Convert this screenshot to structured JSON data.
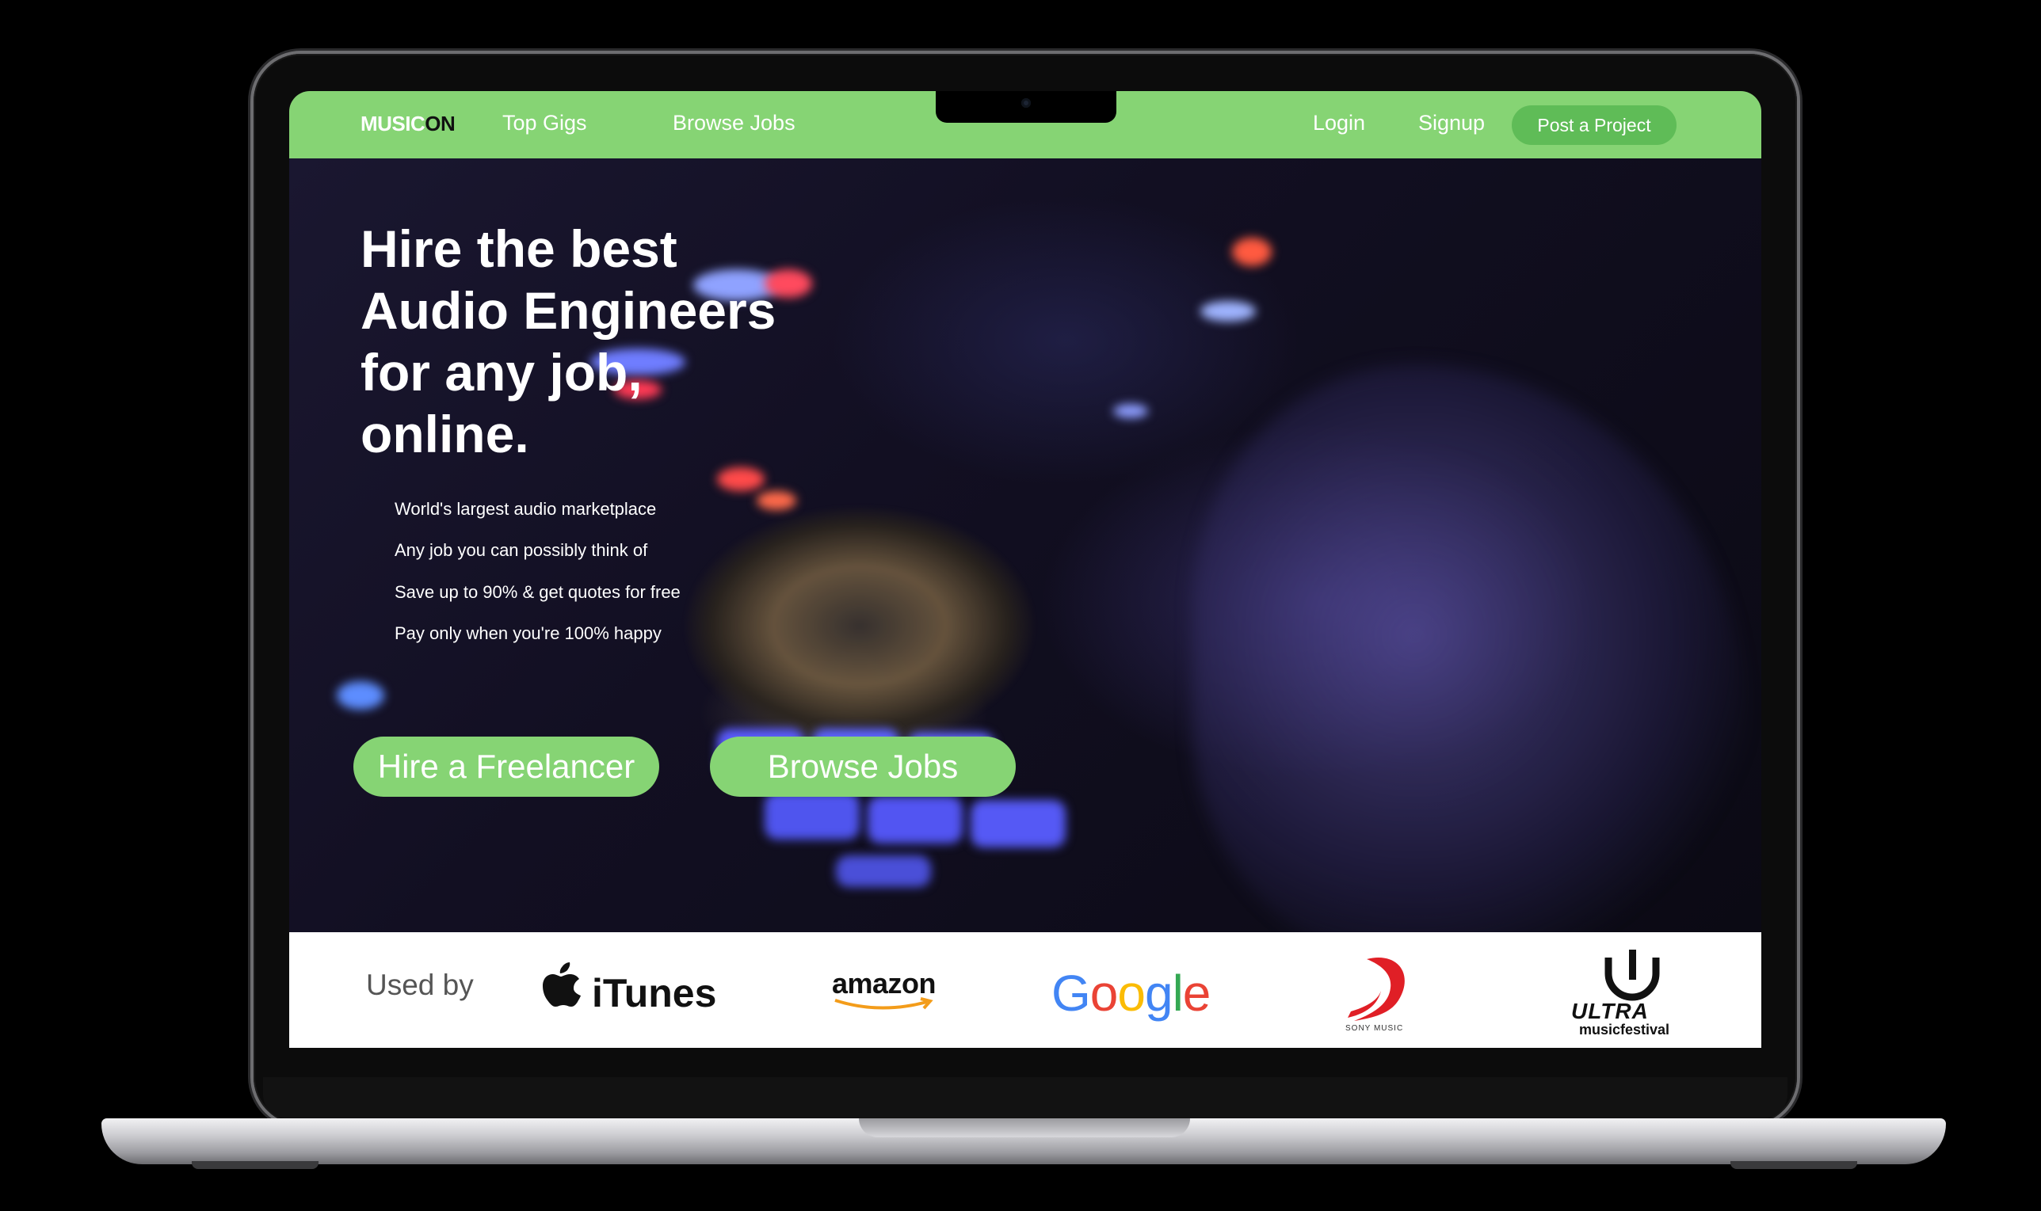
{
  "nav": {
    "logo_part1": "MUSIC",
    "logo_part2": "ON",
    "top_gigs": "Top Gigs",
    "browse_jobs": "Browse Jobs",
    "login": "Login",
    "signup": "Signup",
    "post_project": "Post a Project"
  },
  "hero": {
    "title_lines": [
      "Hire the best",
      "Audio Engineers",
      "for any job,",
      "online."
    ],
    "features": [
      "World's largest audio marketplace",
      "Any job you can possibly think of",
      "Save up to 90% & get quotes for free",
      "Pay only when you're 100% happy"
    ],
    "cta_primary": "Hire a Freelancer",
    "cta_secondary": "Browse Jobs"
  },
  "used_by": {
    "label": "Used by",
    "logos": [
      "iTunes",
      "amazon",
      "Google",
      "SONY MUSIC",
      "ULTRA",
      "musicfestival"
    ]
  },
  "colors": {
    "brand_green": "#86d474",
    "post_button_green": "#5fbc57"
  },
  "icons": [
    "apple-icon",
    "amazon-smile-icon",
    "sony-music-icon",
    "ultra-u-icon"
  ]
}
